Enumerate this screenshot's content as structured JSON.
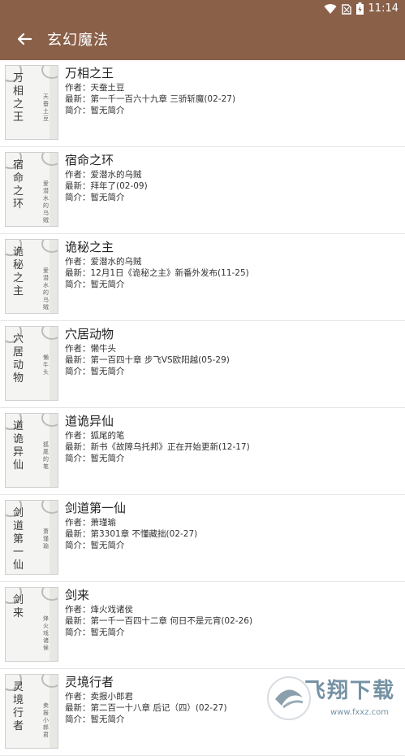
{
  "status": {
    "time": "11:14"
  },
  "appbar": {
    "title": "玄幻魔法"
  },
  "labels": {
    "author": "作者：",
    "latest": "最新：",
    "intro": "简介："
  },
  "books": [
    {
      "title": "万相之王",
      "author": "天蚕土豆",
      "latest": "第一千一百六十九章 三骄斩魔(02-27)",
      "intro": "暂无简介",
      "cover_title": "万相之王",
      "cover_author": "天蚕土豆"
    },
    {
      "title": "宿命之环",
      "author": "爱潜水的乌贼",
      "latest": "拜年了(02-09)",
      "intro": "暂无简介",
      "cover_title": "宿命之环",
      "cover_author": "爱潜水的乌贼"
    },
    {
      "title": "诡秘之主",
      "author": "爱潜水的乌贼",
      "latest": "12月1日《诡秘之主》新番外发布(11-25)",
      "intro": "暂无简介",
      "cover_title": "诡秘之主",
      "cover_author": "爱潜水的乌贼"
    },
    {
      "title": "穴居动物",
      "author": "懒牛头",
      "latest": "第一百四十章 步飞VS欧阳越(05-29)",
      "intro": "暂无简介",
      "cover_title": "穴居动物",
      "cover_author": "懒牛头"
    },
    {
      "title": "道诡异仙",
      "author": "狐尾的笔",
      "latest": "新书《故障乌托邦》正在开始更新(12-17)",
      "intro": "暂无简介",
      "cover_title": "道诡异仙",
      "cover_author": "狐尾的笔"
    },
    {
      "title": "剑道第一仙",
      "author": "萧瑾瑜",
      "latest": "第3301章 不懂藏拙(02-27)",
      "intro": "暂无简介",
      "cover_title": "剑道第一仙",
      "cover_author": "萧瑾瑜"
    },
    {
      "title": "剑来",
      "author": "烽火戏诸侯",
      "latest": "第一千一百四十二章 何日不是元宵(02-26)",
      "intro": "暂无简介",
      "cover_title": "剑来",
      "cover_author": "烽火戏诸侯"
    },
    {
      "title": "灵境行者",
      "author": "卖报小郎君",
      "latest": "第二百一十八章 后记（四）(02-27)",
      "intro": "暂无简介",
      "cover_title": "灵境行者",
      "cover_author": "卖报小郎君"
    }
  ],
  "watermark": {
    "text": "飞翔下载",
    "sub": "www.fxxz.com"
  }
}
